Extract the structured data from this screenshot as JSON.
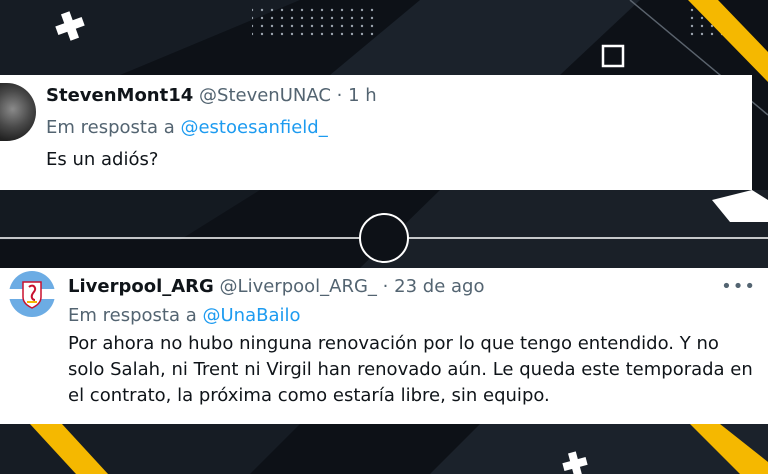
{
  "colors": {
    "accent": "#1d9bf0",
    "brand_yellow": "#f5b800",
    "background": "#0d1117"
  },
  "tweets": [
    {
      "display_name": "StevenMont14",
      "handle": "@StevenUNAC",
      "separator": "·",
      "time": "1 h",
      "reply_prefix": "Em resposta a",
      "reply_to": "@estoesanfield_",
      "text": "Es un adiós?",
      "avatar": "profile-photo"
    },
    {
      "display_name": "Liverpool_ARG",
      "handle": "@Liverpool_ARG_",
      "separator": "·",
      "time": "23 de ago",
      "reply_prefix": "Em resposta a",
      "reply_to": "@UnaBailo",
      "text_lines": [
        "Por ahora no hubo ninguna renovación por lo que tengo entendido. Y no",
        "solo Salah, ni Trent ni Virgil han renovado aún. Le queda este temporada en",
        "el contrato, la próxima como estaría libre, sin equipo."
      ],
      "more_icon": "more-horizontal-icon",
      "avatar": "liverpool-crest-logo"
    }
  ]
}
